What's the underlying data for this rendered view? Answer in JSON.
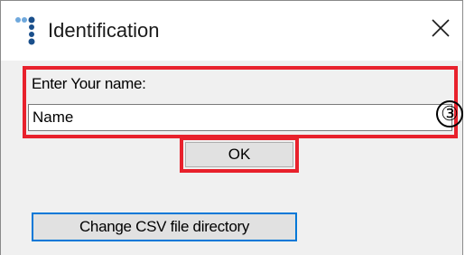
{
  "window": {
    "title": "Identification",
    "icon": "app-dots-icon",
    "close_icon": "close-icon"
  },
  "name_group": {
    "label": "Enter Your name:",
    "input_value": "Name",
    "callout": "③"
  },
  "buttons": {
    "ok_label": "OK",
    "csv_label": "Change CSV file directory"
  },
  "colors": {
    "highlight": "#e8212c",
    "focus_border": "#0078d7",
    "icon_blue": "#1a4f8b",
    "icon_light": "#6fa8dc"
  }
}
